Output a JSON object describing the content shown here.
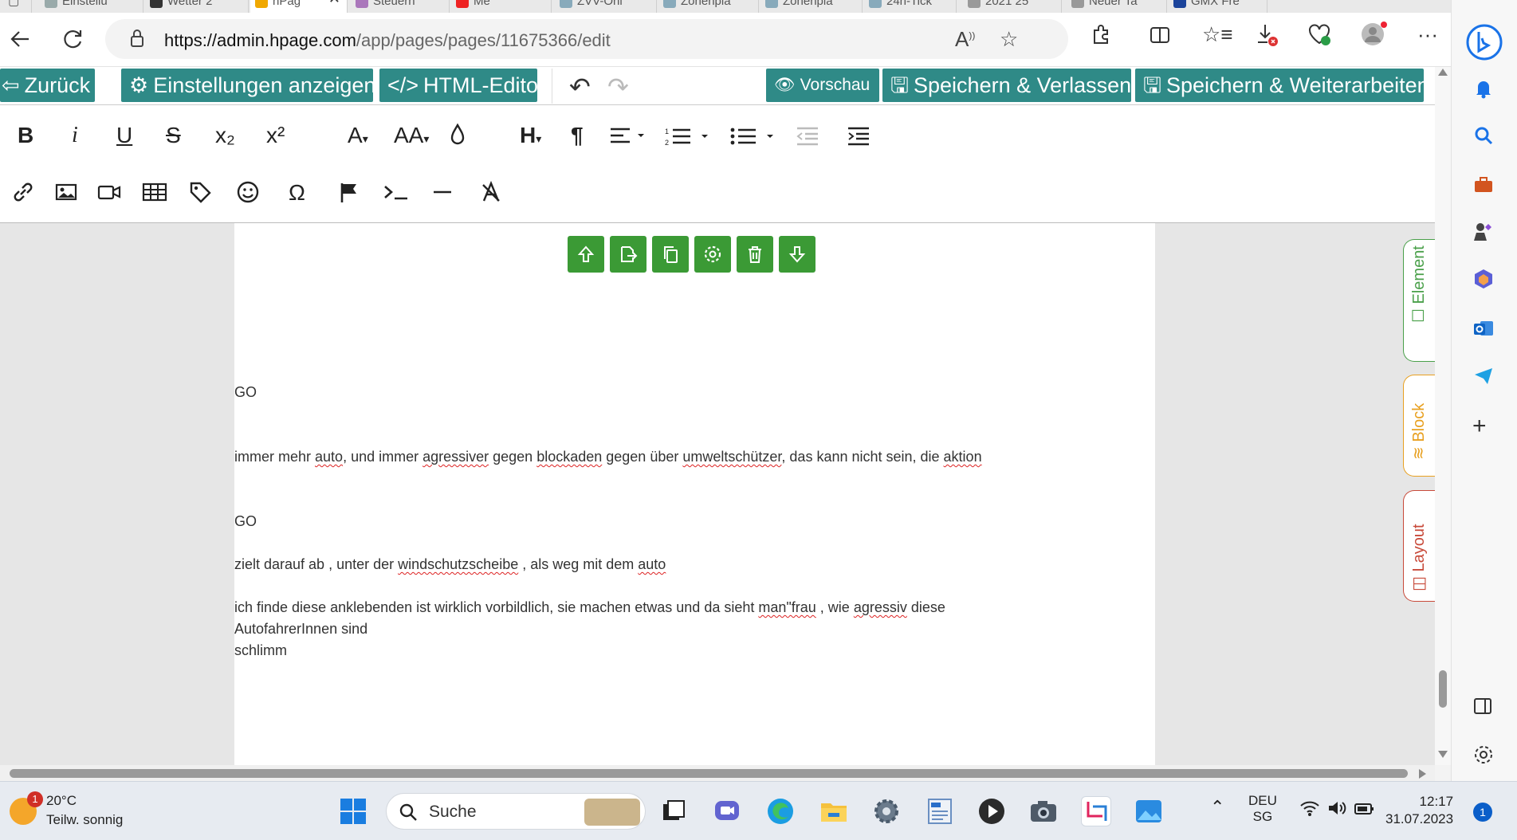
{
  "browser": {
    "tabs": [
      {
        "label": "Einstellu",
        "fav": "#9aa"
      },
      {
        "label": "Wetter 2",
        "fav": "#333"
      },
      {
        "label": "hPag",
        "fav": "#f0a800"
      },
      {
        "label": "Steuern",
        "fav": "#a7b"
      },
      {
        "label": "Me",
        "fav": "#e22"
      },
      {
        "label": "ZVV-Onl",
        "fav": "#8ab"
      },
      {
        "label": "Zonenpla",
        "fav": "#8ab"
      },
      {
        "label": "Zonenpla",
        "fav": "#8ab"
      },
      {
        "label": "24h-Tick",
        "fav": "#8ab"
      },
      {
        "label": "2021 25",
        "fav": "#999"
      },
      {
        "label": "Neuer Ta",
        "fav": "#999"
      },
      {
        "label": "GMX Fre",
        "fav": "#1c449b"
      }
    ],
    "active_tab_close": "✕",
    "url_host": "https://admin.hpage.com",
    "url_path": "/app/pages/pages/11675366/edit"
  },
  "toolbar": {
    "back_label": "Zurück",
    "settings_label": "Einstellungen anzeigen",
    "html_editor_label": "HTML-Editor",
    "preview_label": "Vorschau",
    "save_exit_label": "Speichern & Verlassen",
    "save_continue_label": "Speichern & Weiterarbeiten"
  },
  "format": {
    "bold": "B",
    "italic": "i",
    "underline": "U",
    "strike": "S",
    "subscript": "x₂",
    "superscript": "x²",
    "font": "A",
    "fontsize": "AA",
    "heading": "H",
    "paragraph": "¶",
    "special_char": "Ω"
  },
  "content": {
    "line1": "GO",
    "line2_parts": [
      "immer mehr ",
      "auto",
      ", und immer ",
      "agressiver",
      " gegen ",
      "blockaden",
      " gegen über ",
      "umweltschützer",
      ", das kann nicht sein, die ",
      "aktion"
    ],
    "line3": "GO",
    "line4_parts": [
      "zielt darauf ab , unter der ",
      "windschutzscheibe",
      " , als weg mit dem ",
      "auto"
    ],
    "line5_parts": [
      "ich finde diese anklebenden ist wirklich vorbildlich, sie machen etwas und da sieht ",
      "man\"frau",
      " , wie ",
      "agressiv",
      " diese"
    ],
    "line6": "AutofahrerInnen sind",
    "line7": "schlimm"
  },
  "sidetabs": {
    "element": "Element",
    "block": "Block",
    "layout": "Layout"
  },
  "taskbar": {
    "temperature": "20°C",
    "condition": "Teilw. sonnig",
    "weather_badge": "1",
    "search_label": "Suche",
    "lang_top": "DEU",
    "lang_bottom": "SG",
    "time": "12:17",
    "date": "31.07.2023",
    "notifications": "1"
  },
  "colors": {
    "accent": "#2f8a87",
    "block_tool": "#3b9a35",
    "element_tab": "#4aa04a",
    "block_tab": "#e8a020",
    "layout_tab": "#c84a3a"
  }
}
